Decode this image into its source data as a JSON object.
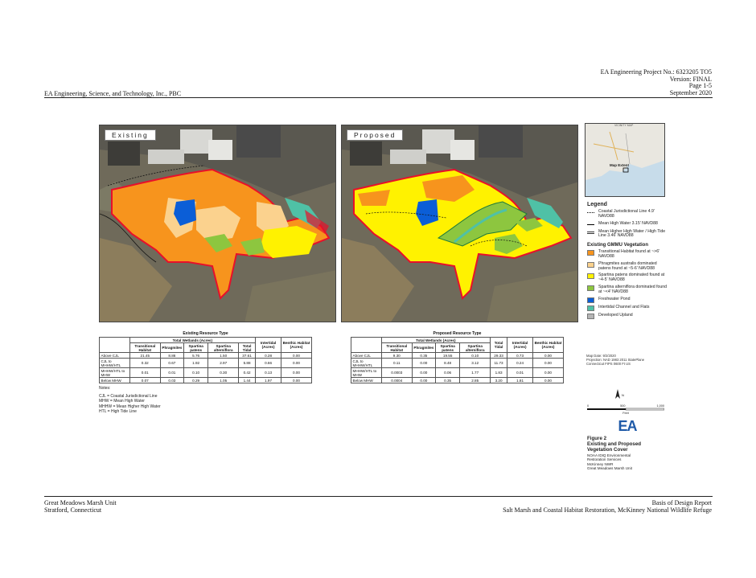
{
  "header": {
    "project_no": "EA Engineering Project No.:  6323205 TO5",
    "version": "Version:  FINAL",
    "page": "Page 1-5",
    "company": "EA Engineering, Science, and Technology, Inc., PBC",
    "date": "September 2020"
  },
  "footer": {
    "unit": "Great Meadows Marsh Unit",
    "location": "Stratford, Connecticut",
    "report": "Basis of Design Report",
    "project": "Salt Marsh and Coastal Habitat Restoration, McKinney National Wildlife Refuge"
  },
  "maps": {
    "existing_label": "Existing",
    "proposed_label": "Proposed",
    "inset_label": "Map Extent",
    "inset_top": "VICINITY MAP"
  },
  "legend": {
    "title": "Legend",
    "lines": [
      {
        "label": "Coastal Jurisdictional Line 4.9' NAVD88",
        "style": "dotted"
      },
      {
        "label": "Mean High Water 3.15' NAVD88",
        "style": "solid"
      },
      {
        "label": "Mean Higher High Water /  High Tide Line 3.46' NAVD88",
        "style": "double"
      }
    ],
    "vegetation_title": "Existing GMMU Vegetation",
    "items": [
      {
        "label": "Transitional Habitat found at ~>6' NAVD88",
        "color": "#f7941d"
      },
      {
        "label": "Phragmites australis dominated patens found at ~5-6' NAVD88",
        "color": "#fbd28e"
      },
      {
        "label": "Spartina patens dominated found at ~4-5' NAVD88",
        "color": "#fff200"
      },
      {
        "label": "Spartina alterniflora dominated found at ~<4' NAVD88",
        "color": "#8dc63f"
      },
      {
        "label": "Freshwater Pond",
        "color": "#0b5ed7"
      },
      {
        "label": "Intertidal Channel and Flats",
        "color": "#4fc1a6"
      },
      {
        "label": "Developed Upland",
        "color": "#b5b5b5"
      }
    ]
  },
  "map_meta": {
    "date": "Map Date: 9/2/2020",
    "projection": "Projection: NAD 1983 2011 StatePlane",
    "fips": "Connecticut FIPS 0600 Ft US"
  },
  "scale": {
    "labels": [
      "0",
      "500",
      "1,000"
    ],
    "unit": "Feet",
    "north": "N"
  },
  "figure": {
    "logo": "EA",
    "number": "Figure 2",
    "title_1": "Existing and Proposed",
    "title_2": "Vegetation Cover",
    "sub_1": "NOAA IDIQ Environmental",
    "sub_2": "Restoration Services",
    "sub_3": "McKinney NWR",
    "sub_4": "Great Meadows Marsh Unit"
  },
  "notes": {
    "title": "Notes:",
    "lines": [
      "CJL = Coastal Jurisdictional Line",
      "MHW = Mean High Water",
      "MHHW = Mean Higher High Water",
      "HTL = High Tide Line"
    ]
  },
  "existing_table": {
    "caption": "Existing Resource Type",
    "group_header": "Total Wetlands (Acres)",
    "columns": [
      "",
      "Transitional Habitat",
      "Phragmites",
      "Spartina patens",
      "Spartina alterniflora",
      "Total Tidal",
      "Intertidal (Acres)",
      "Benthic Habitat (Acres)"
    ],
    "rows": [
      [
        "Above CJL",
        "21.45",
        "8.86",
        "5.76",
        "1.50",
        "37.61",
        "0.28",
        "0.00"
      ],
      [
        "CJL to MHHW/HTL",
        "0.32",
        "0.67",
        "1.92",
        "2.97",
        "5.88",
        "0.66",
        "0.00"
      ],
      [
        "MHHW/HTL to MHW",
        "0.01",
        "0.01",
        "0.10",
        "0.30",
        "0.42",
        "0.13",
        "0.00"
      ],
      [
        "Below MHW",
        "0.07",
        "0.03",
        "0.29",
        "1.05",
        "1.44",
        "1.97",
        "0.00"
      ]
    ]
  },
  "proposed_table": {
    "caption": "Proposed Resource Type",
    "group_header": "Total Wetlands (Acres)",
    "columns": [
      "",
      "Transitional Habitat",
      "Phragmites",
      "Spartina patens",
      "Spartina alterniflora",
      "Total Tidal",
      "Intertidal (Acres)",
      "Benthic Habitat (Acres)"
    ],
    "rows": [
      [
        "Above CJL",
        "9.30",
        "0.35",
        "19.55",
        "0.10",
        "29.33",
        "0.73",
        "0.00"
      ],
      [
        "CJL to MHHW/HTL",
        "0.11",
        "0.00",
        "8.48",
        "3.12",
        "11.73",
        "0.24",
        "0.00"
      ],
      [
        "MHHW/HTL to MHW",
        "0.0003",
        "0.00",
        "0.06",
        "1.77",
        "1.83",
        "0.01",
        "0.00"
      ],
      [
        "Below MHW",
        "0.0004",
        "0.00",
        "0.35",
        "2.85",
        "3.20",
        "1.81",
        "0.00"
      ]
    ]
  }
}
